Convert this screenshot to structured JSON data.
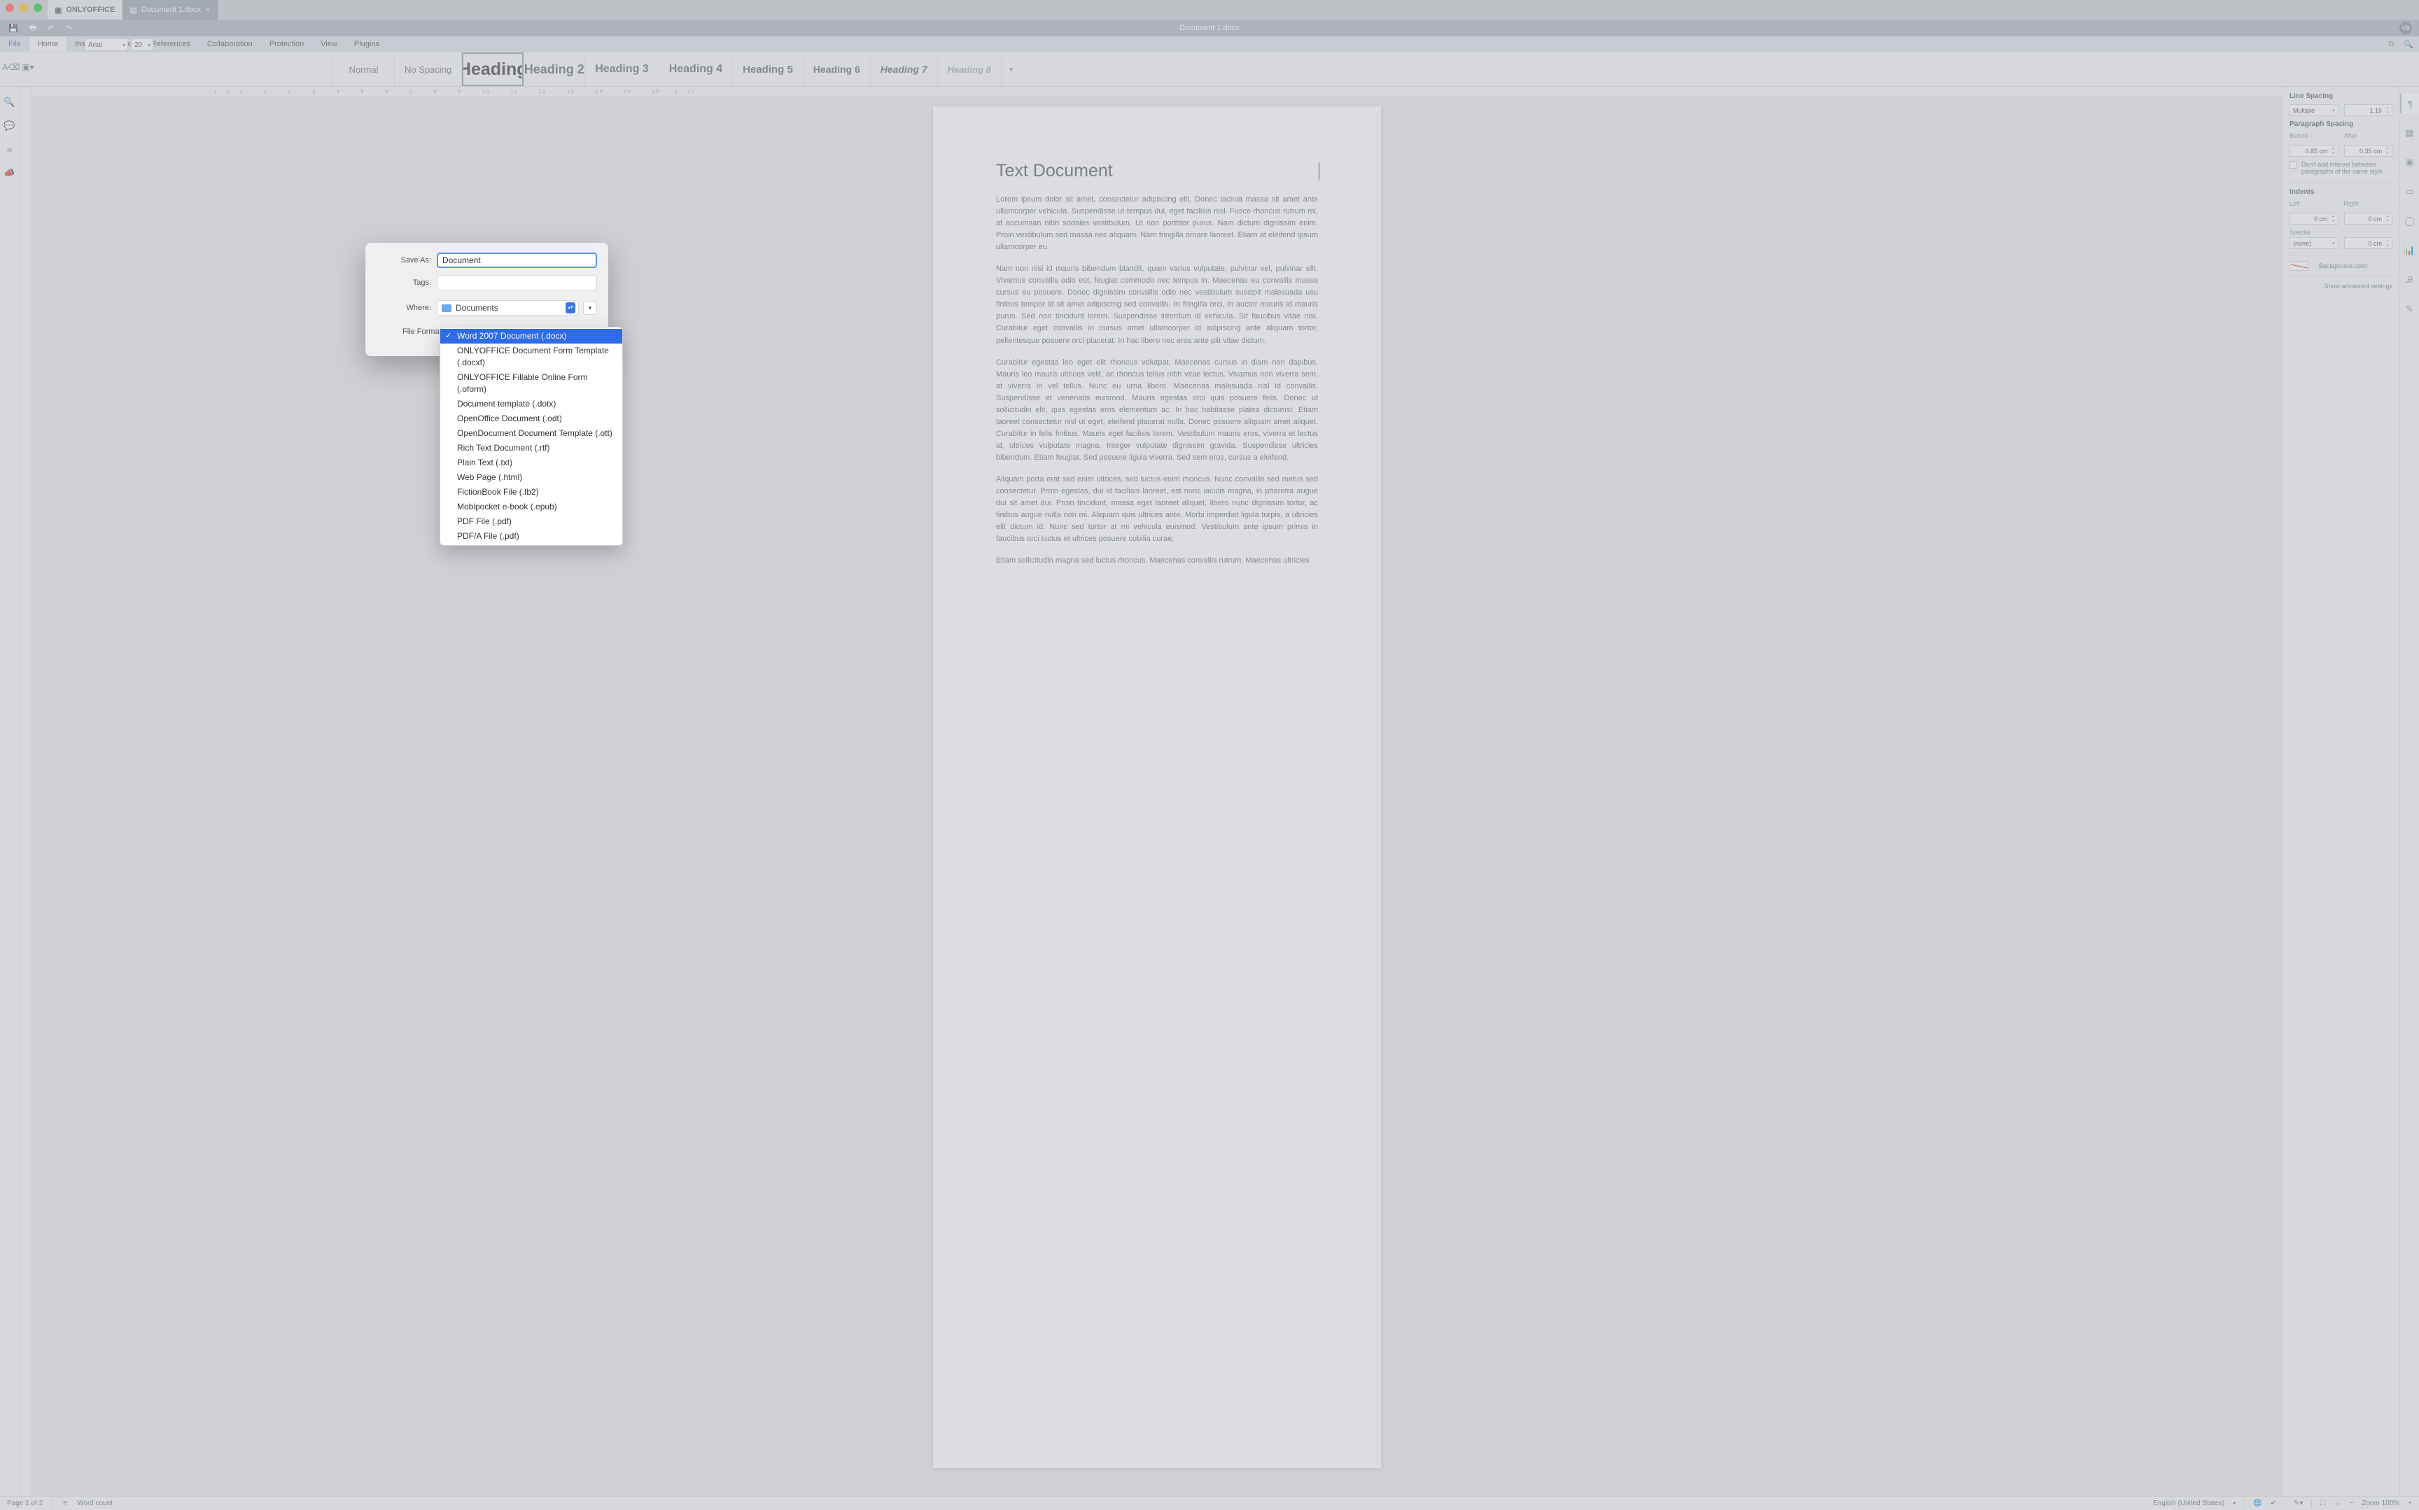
{
  "window": {
    "app_tab": "ONLYOFFICE",
    "doc_tab": "Document 1.docx",
    "title": "Document 1.docx",
    "avatar": "VB"
  },
  "menu": {
    "file": "File",
    "home": "Home",
    "insert": "Insert",
    "layout": "Layout",
    "references": "References",
    "collaboration": "Collaboration",
    "protection": "Protection",
    "view": "View",
    "plugins": "Plugins"
  },
  "toolbar": {
    "font_name": "Arial",
    "font_size": "20"
  },
  "styles": {
    "normal": "Normal",
    "no_spacing": "No Spacing",
    "h1": "Heading",
    "h2": "Heading 2",
    "h3": "Heading 3",
    "h4": "Heading 4",
    "h5": "Heading 5",
    "h6": "Heading 6",
    "h7": "Heading 7",
    "h8": "Heading 8"
  },
  "ruler": "1 · 2 · 1 · · · 1 · · · 2 · · · 3 · · · 4 · · · 5 · · · 6 · · · 7 · · · 8 · · · 9 · · · 10 · · · 11 · · · 12 · · · 13 · · · 14 · · · 15 · · · 16 · · 1 · 17",
  "doc": {
    "heading": "Text Document",
    "p1": "Lorem ipsum dolor sit amet, consectetur adipiscing elit. Donec lacinia massa sit amet ante ullamcorper vehicula. Suspendisse ut tempus dui, eget facilisis nisl. Fusce rhoncus rutrum mi, at accumsan nibh sodales vestibulum. Ut non porttitor purus. Nam dictum dignissim enim. Proin vestibulum sed massa nec aliquam. Nam fringilla ornare laoreet. Etiam at eleifend ipsum ullamcorper eu.",
    "p2": "Nam non nisi id mauris bibendum blandit, quam varius vulputate, pulvinar vel, pulvinar elit. Vivamus convallis odio est, feugiat commodo nec tempus in. Maecenas eu convallis massa cursus eu posuere. Donec dignissim convallis odio nec vestibulum suscipit malesuada usu finibus tempor id sit amet adipiscing sed convallis. In fringilla orci, in auctor mauris id mauris purus. Sed non tincidunt lorem. Suspendisse interdum id vehicula. Sit faucibus vitae nisi. Curabitur eget convallis in cursus amet ullamcorper id adipiscing ante aliquam tortor, pellentesque posuere orci placerat. In hac libero nec eros ante plit vitae dictum.",
    "p3": "Curabitur egestas leo eget elit rhoncus volutpat. Maecenas cursus in diam non dapibus. Mauris leo mauris ultrices velit, ac rhoncus tellus nibh vitae lectus. Vivamus non viverra sem, at viverra in vel tellus. Nunc eu urna libero. Maecenas malesuada nisl id convallis. Suspendisse et venenatis euismod. Mauris egestas orci quis posuere felis. Donec ut sollicitudin elit, quis egestas eros elementum ac. In hac habitasse platea dictumst. Etiam laoreet consectetur nisl ut eget, eleifend placerat nulla. Donec posuere aliquam amet aliquet. Curabitur in felis finibus. Mauris eget facilisis lorem. Vestibulum mauris eros, viverra et lectus id, ultrices vulputate magna. Integer vulputate dignissim gravida. Suspendisse ultricies bibendum. Etiam feugiat. Sed posuere ligula viverra. Sed sem eros, cursus a eleifend.",
    "p4": "Aliquam porta erat sed enim ultrices, sed luctus enim rhoncus. Nunc convallis sed metus sed consectetur. Proin egestas, dui id facilisis laoreet, est nunc iaculis magna, in pharetra augue dui sit amet dui. Proin tincidunt, massa eget laoreet aliquet, libero nunc dignissim tortor, ac finibus augue nulla non mi. Aliquam quis ultrices ante. Morbi imperdiet ligula turpis, a ultricies elit dictum id. Nunc sed tortor at mi vehicula euismod. Vestibulum ante ipsum primis in faucibus orci luctus et ultrices posuere cubilia curae;",
    "p5": "Etiam sollicitudin magna sed luctus rhoncus. Maecenas convallis rutrum. Maecenas ultricies"
  },
  "props": {
    "line_spacing_label": "Line Spacing",
    "line_spacing_mode": "Multiple",
    "line_spacing_value": "1.15",
    "para_spacing_label": "Paragraph Spacing",
    "before_label": "Before",
    "after_label": "After",
    "before_value": "0.85 cm",
    "after_value": "0.35 cm",
    "dont_add_label": "Don't add interval between paragraphs of the same style",
    "indents_label": "Indents",
    "left_label": "Left",
    "right_label": "Right",
    "left_value": "0 cm",
    "right_value": "0 cm",
    "special_label": "Special",
    "special_value": "(none)",
    "special_by": "0 cm",
    "bg_label": "Background color",
    "advanced": "Show advanced settings"
  },
  "status": {
    "page": "Page 1 of 2",
    "word_count": "Word count",
    "lang": "English (United States)",
    "zoom": "Zoom 100%"
  },
  "dialog": {
    "save_as_label": "Save As:",
    "save_as_value": "Document",
    "tags_label": "Tags:",
    "tags_value": "",
    "where_label": "Where:",
    "where_value": "Documents",
    "format_label": "File Format:",
    "formats": [
      "Word 2007 Document (.docx)",
      "ONLYOFFICE Document Form Template (.docxf)",
      "ONLYOFFICE Fillable Online Form (.oform)",
      "Document template (.dotx)",
      "OpenOffice Document (.odt)",
      "OpenDocument Document Template (.ott)",
      "Rich Text Document (.rtf)",
      "Plain Text (.txt)",
      "Web Page (.html)",
      "FictionBook File (.fb2)",
      "Mobipocket e-book (.epub)",
      "PDF File (.pdf)",
      "PDF/A File (.pdf)"
    ]
  }
}
